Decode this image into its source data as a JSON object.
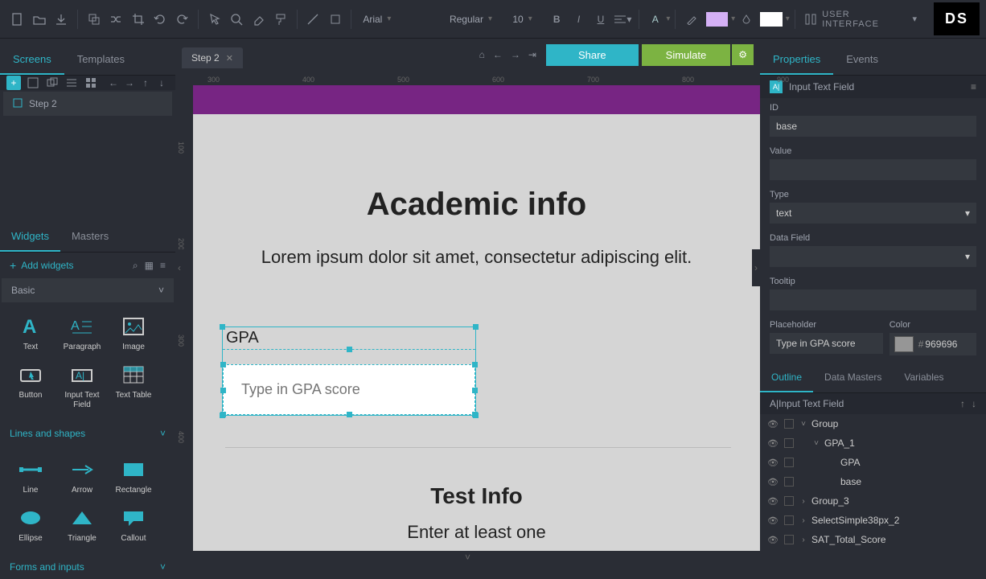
{
  "toolbar": {
    "font_family": "Arial",
    "font_weight": "Regular",
    "font_size": "10",
    "ui_label": "USER INTERFACE",
    "brand": "DS"
  },
  "left": {
    "tabs": {
      "screens": "Screens",
      "templates": "Templates"
    },
    "screen_name": "Step 2",
    "widgets_tab": "Widgets",
    "masters_tab": "Masters",
    "add_widgets": "Add widgets",
    "basic": "Basic",
    "w": {
      "text": "Text",
      "paragraph": "Paragraph",
      "image": "Image",
      "button": "Button",
      "input": "Input Text Field",
      "table": "Text Table",
      "line": "Line",
      "arrow": "Arrow",
      "rect": "Rectangle",
      "ellipse": "Ellipse",
      "triangle": "Triangle",
      "callout": "Callout"
    },
    "lines_shapes": "Lines and shapes",
    "forms_inputs": "Forms and inputs"
  },
  "center": {
    "tab_name": "Step 2",
    "share": "Share",
    "simulate": "Simulate",
    "ruler_h": [
      "300",
      "400",
      "500",
      "600",
      "700",
      "800",
      "900"
    ],
    "ruler_v": [
      "100",
      "200",
      "300",
      "400"
    ],
    "page": {
      "h1": "Academic info",
      "sub": "Lorem ipsum dolor sit amet, consectetur adipiscing elit.",
      "gpa_label": "GPA",
      "gpa_placeholder": "Type in GPA score",
      "test_info": "Test Info",
      "enter_one": "Enter at least one"
    }
  },
  "right": {
    "tabs": {
      "props": "Properties",
      "events": "Events"
    },
    "element_type": "Input Text Field",
    "id_label": "ID",
    "id_value": "base",
    "value_label": "Value",
    "value_value": "",
    "type_label": "Type",
    "type_value": "text",
    "datafield_label": "Data Field",
    "tooltip_label": "Tooltip",
    "placeholder_label": "Placeholder",
    "placeholder_value": "Type in GPA score",
    "color_label": "Color",
    "color_value": "969696",
    "outline_tabs": {
      "outline": "Outline",
      "dm": "Data Masters",
      "vars": "Variables"
    },
    "outline_title": "Input Text Field",
    "outline": [
      {
        "n": "Group",
        "i": 1,
        "exp": "v"
      },
      {
        "n": "GPA_1",
        "i": 2,
        "exp": "v"
      },
      {
        "n": "GPA",
        "i": 3,
        "exp": ""
      },
      {
        "n": "base",
        "i": 3,
        "exp": ""
      },
      {
        "n": "Group_3",
        "i": 1,
        "exp": ">"
      },
      {
        "n": "SelectSimple38px_2",
        "i": 1,
        "exp": ">"
      },
      {
        "n": "SAT_Total_Score",
        "i": 1,
        "exp": ">"
      }
    ]
  }
}
